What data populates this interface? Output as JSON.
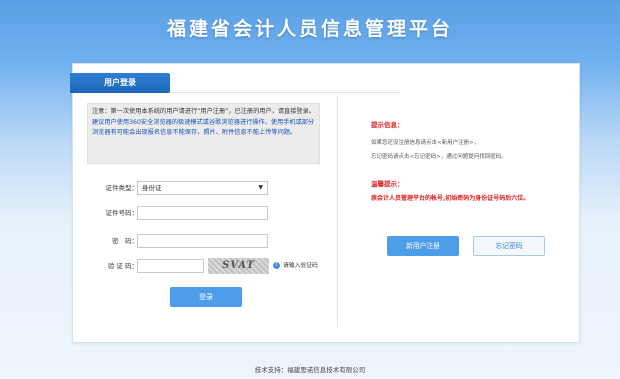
{
  "header": {
    "title": "福建省会计人员信息管理平台"
  },
  "login": {
    "tab_label": "用户登录",
    "notice": {
      "part1": "注意：第一次使用本系统的用户请进行“用户注册”，已注册的用户，请直接登录。",
      "part2": "建议用户使用360安全浏览器的极速模式或谷歌浏览器进行操作，使用手机或部分浏览器有可能会出现报名信息不能保存，照片、附件信息不能上传等问题。"
    },
    "fields": {
      "id_type_label": "证件类型：",
      "id_type_value": "身份证",
      "id_number_label": "证件号码：",
      "password_label": "密　码：",
      "captcha_label": "验 证 码：",
      "captcha_image_text": "SVAT",
      "captcha_hint": "请输入验证码"
    },
    "login_button": "登录"
  },
  "info": {
    "title": "提示信息：",
    "line1": "如果您还没注册信息请点击<新用户注册>，",
    "line2": "忘记密码请点击<忘记密码>，通过问题提问找回密码。",
    "warn_title": "温馨提示：",
    "warn_text": "原会计人员管理平台的帐号,初始密码为身份证号码后六位。",
    "register_button": "新用户注册",
    "forgot_button": "忘记密码"
  },
  "footer": {
    "text": "技术支持：福建思诺信息技术有限公司"
  },
  "colors": {
    "primary_blue": "#4d9de8",
    "warning_red": "#dd2222",
    "header_blue": "#5aa0e6"
  }
}
